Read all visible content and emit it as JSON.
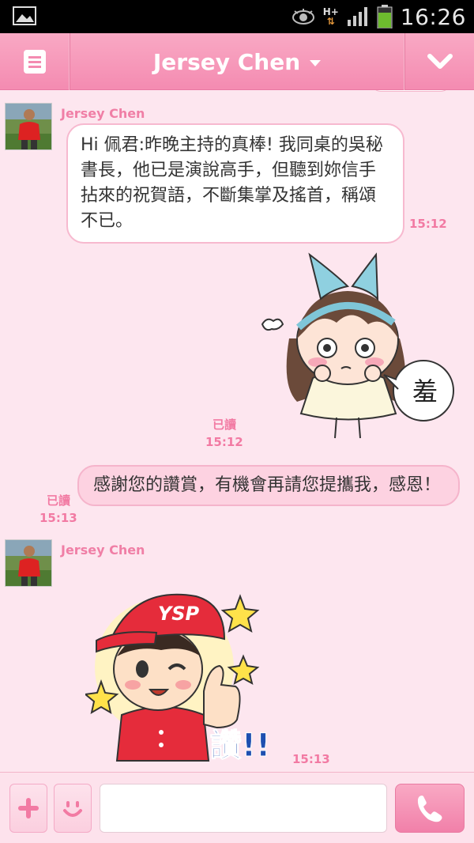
{
  "status_bar": {
    "time": "16:26",
    "network": "H+"
  },
  "header": {
    "title": "Jersey Chen"
  },
  "messages": [
    {
      "sender": "Jersey Chen",
      "text": "Hi 佩君:昨晚主持的真棒! 我同桌的吳秘書長，他已是演說高手，但聽到妳信手拈來的祝賀語，不斷集掌及搖首，稱頌不已。",
      "time": "15:12"
    },
    {
      "read": "已讀",
      "time": "15:12",
      "sticker_text": "羞"
    },
    {
      "read": "已讀",
      "time": "15:13",
      "text": "感謝您的讚賞，有機會再請您提攜我，感恩！"
    },
    {
      "sender": "Jersey Chen",
      "time": "15:13",
      "sticker_cap": "YSP",
      "sticker_text": "讚!!"
    }
  ],
  "input": {
    "placeholder": ""
  },
  "colors": {
    "accent": "#f48bb1",
    "background": "#fde6ef",
    "timestamp": "#f27aa3"
  }
}
